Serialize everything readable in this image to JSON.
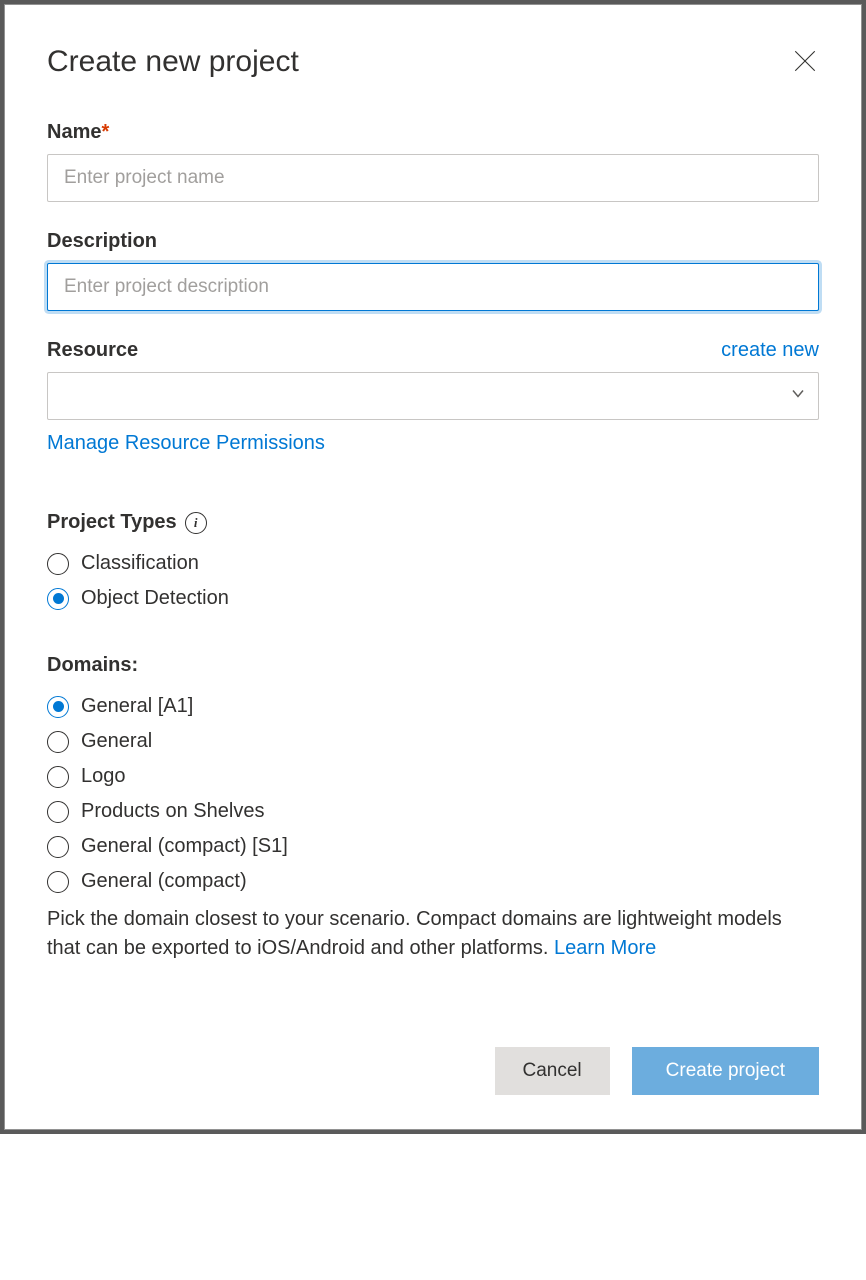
{
  "modal": {
    "title": "Create new project"
  },
  "name": {
    "label": "Name",
    "placeholder": "Enter project name",
    "value": ""
  },
  "description": {
    "label": "Description",
    "placeholder": "Enter project description",
    "value": ""
  },
  "resource": {
    "label": "Resource",
    "create_new_label": "create new",
    "manage_permissions_label": "Manage Resource Permissions",
    "value": ""
  },
  "project_types": {
    "label": "Project Types",
    "options": [
      {
        "label": "Classification",
        "selected": false
      },
      {
        "label": "Object Detection",
        "selected": true
      }
    ]
  },
  "domains": {
    "label": "Domains:",
    "options": [
      {
        "label": "General [A1]",
        "selected": true
      },
      {
        "label": "General",
        "selected": false
      },
      {
        "label": "Logo",
        "selected": false
      },
      {
        "label": "Products on Shelves",
        "selected": false
      },
      {
        "label": "General (compact) [S1]",
        "selected": false
      },
      {
        "label": "General (compact)",
        "selected": false
      }
    ],
    "helper_text": "Pick the domain closest to your scenario. Compact domains are lightweight models that can be exported to iOS/Android and other platforms. ",
    "learn_more_label": "Learn More"
  },
  "buttons": {
    "cancel": "Cancel",
    "create": "Create project"
  }
}
